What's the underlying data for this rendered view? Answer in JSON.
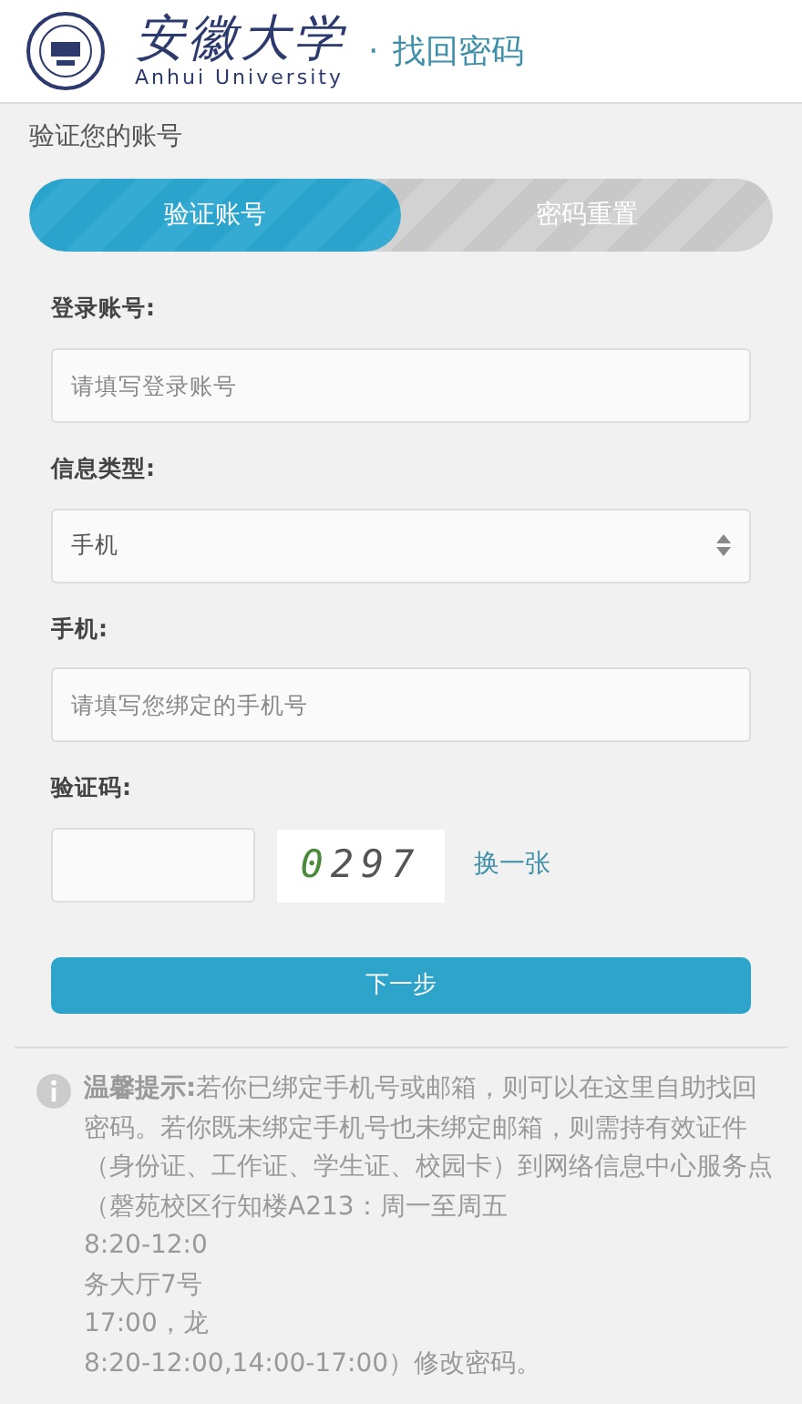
{
  "header": {
    "logo_name": "安徽大学",
    "logo_subtitle": "Anhui University",
    "separator": "·",
    "page_title": "找回密码"
  },
  "section_title": "验证您的账号",
  "steps": [
    {
      "label": "验证账号",
      "selected": true
    },
    {
      "label": "密码重置",
      "selected": false
    }
  ],
  "fields": [
    {
      "kind": "text",
      "label": "登录账号:",
      "placeholder": "请填写登录账号"
    },
    {
      "kind": "select",
      "label": "信息类型:",
      "value": "手机"
    },
    {
      "kind": "text",
      "label": "手机:",
      "placeholder": "请填写您绑定的手机号"
    },
    {
      "kind": "captcha",
      "label": "验证码:",
      "captcha_text": "0297",
      "refresh_link": "换一张"
    }
  ],
  "submit_button": "下一步",
  "tip": {
    "lead": "温馨提示:",
    "text": "若你已绑定手机号或邮箱，则可以在这里自助找回密码。若你既未绑定手机号也未绑定邮箱，则需持有效证件（身份证、工作证、学生证、校园卡）到网络信息中心服务点（磬苑校区行知楼A213：周一至周五",
    "fragments": [
      "8:20-12:0",
      "务大厅7号",
      "17:00，龙",
      "8:20-12:00,14:00-17:00）修改密码。"
    ]
  }
}
